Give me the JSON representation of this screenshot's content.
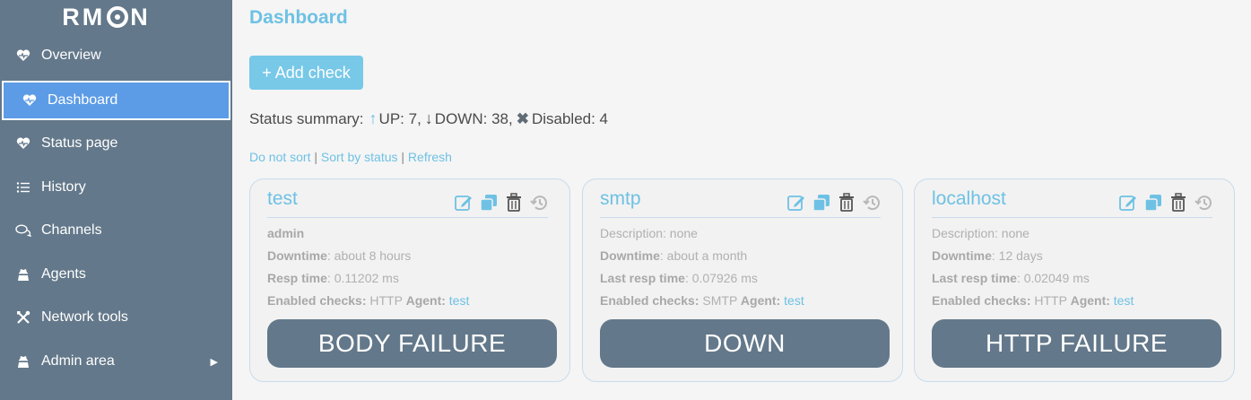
{
  "logo": {
    "text_left": "RM",
    "text_right": "N"
  },
  "sidebar": {
    "items": [
      {
        "label": "Overview",
        "icon": "heart-pulse-icon",
        "active": false
      },
      {
        "label": "Dashboard",
        "icon": "heart-pulse-icon",
        "active": true
      },
      {
        "label": "Status page",
        "icon": "heart-pulse-icon",
        "active": false
      },
      {
        "label": "History",
        "icon": "list-icon",
        "active": false
      },
      {
        "label": "Channels",
        "icon": "chat-icon",
        "active": false
      },
      {
        "label": "Agents",
        "icon": "agent-icon",
        "active": false
      },
      {
        "label": "Network tools",
        "icon": "tools-icon",
        "active": false
      },
      {
        "label": "Admin area",
        "icon": "agent-icon",
        "active": false,
        "has_submenu": true
      }
    ]
  },
  "page": {
    "title": "Dashboard"
  },
  "toolbar": {
    "add_check_label": "+ Add check"
  },
  "summary": {
    "prefix": "Status summary:",
    "up": "UP: 7,",
    "down": "DOWN: 38,",
    "disabled": "Disabled: 4"
  },
  "sort": {
    "do_not_sort": "Do not sort",
    "sort_by_status": "Sort by status",
    "refresh": "Refresh",
    "separator": "|"
  },
  "cards": [
    {
      "name": "test",
      "line1": {
        "bold": "admin",
        "text": ""
      },
      "downtime_label": "Downtime",
      "downtime": ": about 8 hours",
      "resp_label": "Resp time",
      "resp": ": 0.11202 ms",
      "checks_label": "Enabled checks:",
      "checks": " HTTP ",
      "agent_label": "Agent:",
      "agent": "test",
      "status": "BODY FAILURE"
    },
    {
      "name": "smtp",
      "line1": {
        "bold": "",
        "text": "Description: none"
      },
      "downtime_label": "Downtime",
      "downtime": ": about a month",
      "resp_label": "Last resp time",
      "resp": ": 0.07926 ms",
      "checks_label": "Enabled checks:",
      "checks": " SMTP ",
      "agent_label": "Agent:",
      "agent": "test",
      "status": "DOWN"
    },
    {
      "name": "localhost",
      "line1": {
        "bold": "",
        "text": "Description: none"
      },
      "downtime_label": "Downtime",
      "downtime": ": 12 days",
      "resp_label": "Last resp time",
      "resp": ": 0.02049 ms",
      "checks_label": "Enabled checks:",
      "checks": " HTTP ",
      "agent_label": "Agent:",
      "agent": "test",
      "status": "HTTP FAILURE"
    }
  ],
  "colors": {
    "accent": "#6ec1e4",
    "sidebar": "#63788a",
    "active": "#5c9ce6",
    "status_button": "#63788a"
  }
}
